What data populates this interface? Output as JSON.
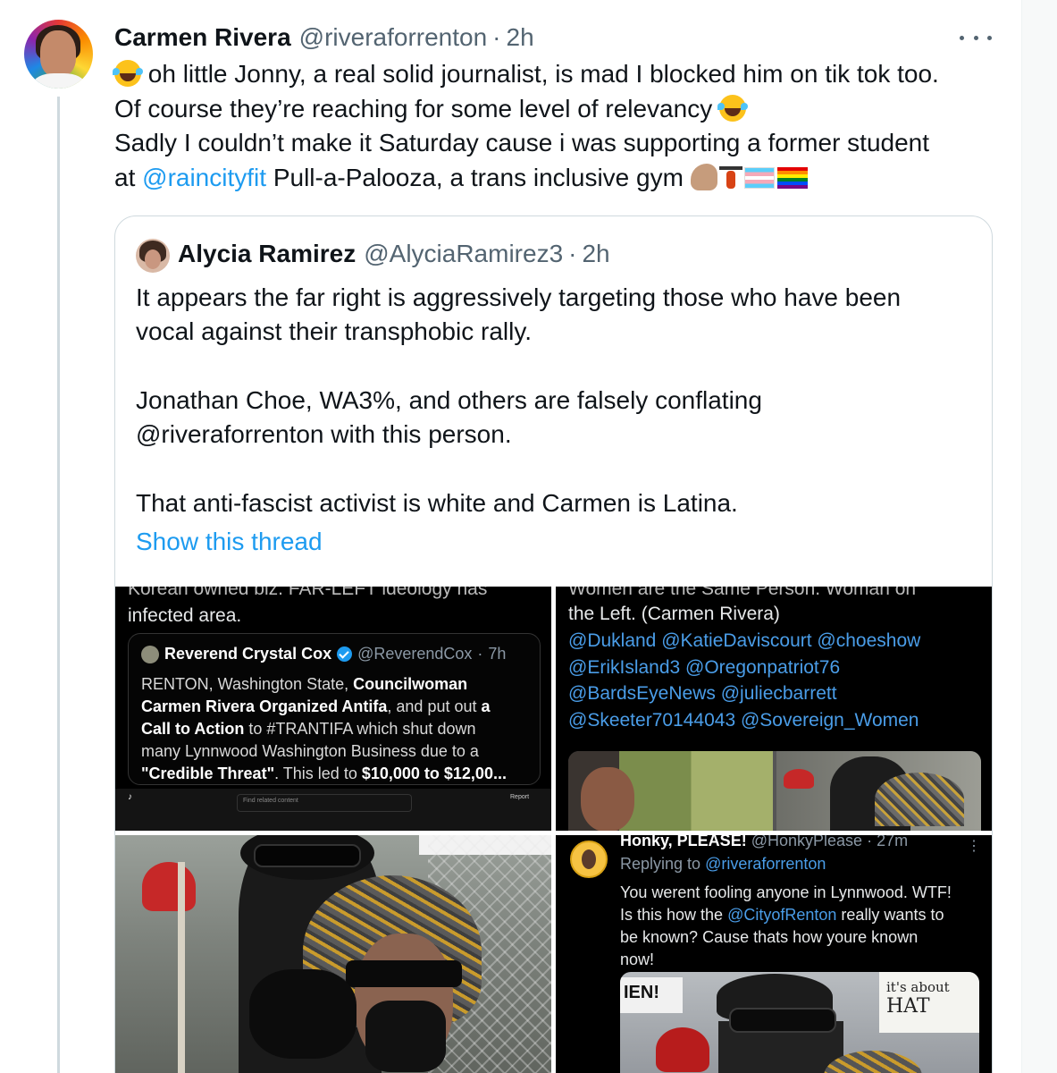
{
  "tweet": {
    "author_name": "Carmen Rivera",
    "author_handle": "@riveraforrenton",
    "dot": "·",
    "time": "2h",
    "lines": {
      "l1": "oh little Jonny, a real solid journalist, is mad I blocked him on tik tok too.",
      "l2": "Of course they’re reaching for some level of relevancy",
      "l3": "Sadly I couldn’t make it Saturday cause i was supporting a former student",
      "l4_pre": "at",
      "l4_mention": "@raincityfit",
      "l4_post": "Pull-a-Palooza, a trans inclusive gym"
    },
    "emojis": [
      "face-with-tears-of-joy",
      "flexed-biceps",
      "weight-lifter",
      "transgender-flag",
      "rainbow-flag"
    ]
  },
  "quote": {
    "author_name": "Alycia Ramirez",
    "author_handle": "@AlyciaRamirez3",
    "dot": "·",
    "time": "2h",
    "lines": {
      "l1": "It appears the far right is aggressively targeting those who have been",
      "l2": "vocal against their transphobic rally.",
      "l3": "Jonathan Choe, WA3%, and others are falsely conflating",
      "l4": "@riveraforrenton with this person.",
      "l5": "That anti-fascist activist is white and Carmen is Latina."
    },
    "show_thread": "Show this thread"
  },
  "media": {
    "top_left": {
      "cut_line": "Korean owned biz. FAR-LEFT ideology has",
      "line2": "infected area.",
      "card": {
        "name": "Reverend Crystal Cox",
        "handle": "@ReverendCox",
        "dot": "·",
        "time": "7h",
        "b1_a": "RENTON, Washington State,",
        "b1_b": "Councilwoman",
        "b2_a": "Carmen Rivera Organized Antifa",
        "b2_b": ", and put out",
        "b2_c": "a",
        "b3_a": "Call to Action",
        "b3_b": "to #TRANTIFA which shut down",
        "b4": "many Lynnwood Washington Business due to a",
        "b5_a": "\"Credible Threat\"",
        "b5_b": ". This led to",
        "b5_c": "$10,000 to $12,00..."
      },
      "tiktok_search": "Find related content",
      "tiktok_report": "Report"
    },
    "top_right": {
      "cut_line": "Women are the Same Person. Woman on",
      "line2": "the Left. (Carmen Rivera)",
      "mentions": [
        "@Dukland  @KatieDaviscourt @choeshow",
        "@ErikIsland3  @Oregonpatriot76",
        "@BardsEyeNews @juliecbarrett",
        "@Skeeter70144043 @Sovereign_Women"
      ]
    },
    "bottom_right": {
      "name": "Honky, PLEASE!",
      "handle": "@HonkyPlease",
      "dot": "·",
      "time": "27m",
      "reply_pre": "Replying to",
      "reply_handle": "@riveraforrenton",
      "b1": "You werent fooling anyone in Lynnwood. WTF!",
      "b2_a": "Is this how the",
      "b2_link": "@CityofRenton",
      "b2_b": "really wants to",
      "b3": "be known? Cause thats how youre known",
      "b4": "now!",
      "sign_left": "IEN!",
      "sign_right_1": "it's about",
      "sign_right_2": "HAT"
    }
  },
  "colors": {
    "link": "#1d9bf0",
    "text": "#0f1419",
    "muted": "#536471",
    "border": "#cfd9de"
  }
}
